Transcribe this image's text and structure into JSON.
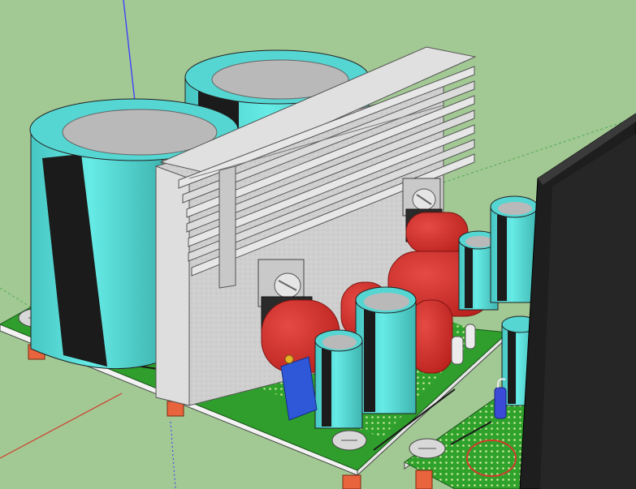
{
  "scene": {
    "kind": "3d-model-viewport",
    "subject": "pcb-power-amplifier-module",
    "colors": {
      "background": "#a2c894",
      "board": "#2f9e2c",
      "board_edge": "#f2f2f2",
      "capacitor_body": "#5ee3df",
      "capacitor_stripe": "#1b1b1b",
      "capacitor_top": "#b9b9b9",
      "heatsink": "#cfcfcf",
      "film_capacitor": "#d8302b",
      "trimmer": "#2f58d8",
      "standoff": "#e8643c",
      "transformer": "#1e1e1e",
      "axis_blue": "#3a3aff",
      "axis_red": "#d23b2c"
    }
  }
}
